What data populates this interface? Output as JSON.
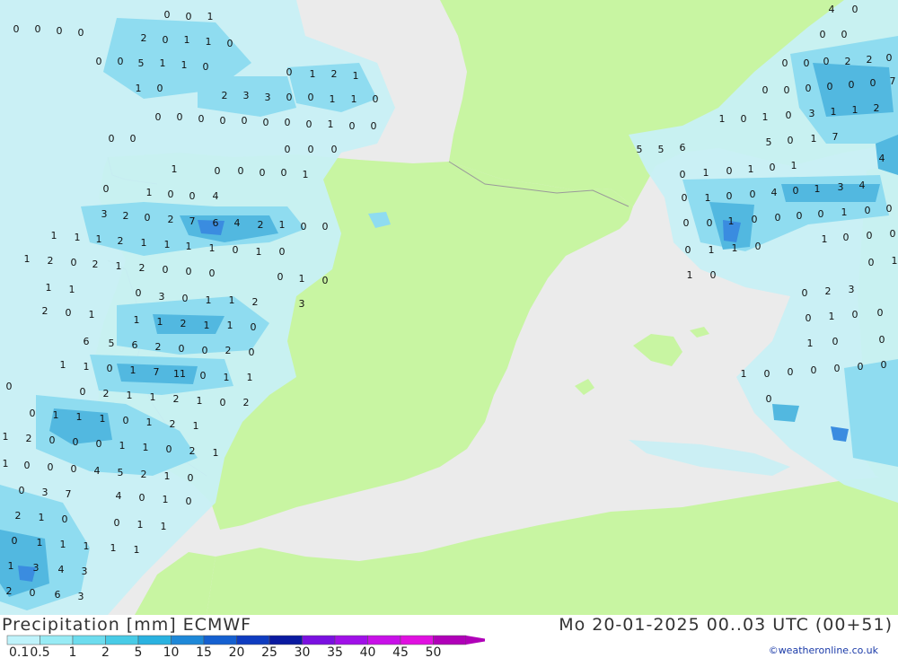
{
  "title": "Precipitation [mm] ECMWF",
  "datetime": "Mo 20-01-2025 00..03 UTC (00+51)",
  "credit": "©weatheronline.co.uk",
  "colors": {
    "sea": "#ebebeb",
    "land": "#c8f5a2",
    "border": "#9a9a9a",
    "precip_low": "#c8f0f5",
    "precip_mid": "#8fdcf0",
    "precip_high": "#52b8e0",
    "precip_max": "#3a8ce0"
  },
  "legend": {
    "labels": [
      "0.1",
      "0.5",
      "1",
      "2",
      "5",
      "10",
      "15",
      "20",
      "25",
      "30",
      "35",
      "40",
      "45",
      "50"
    ],
    "colors": [
      "#bff3fb",
      "#98ebf5",
      "#6ddcee",
      "#48cbe6",
      "#2ab2e0",
      "#1e88d8",
      "#1560d0",
      "#0f3cc0",
      "#0a1aa0",
      "#7a10e0",
      "#a010e8",
      "#c810e8",
      "#e010e0",
      "#b000b8"
    ]
  },
  "precip_values": [
    "0",
    "0",
    "0",
    "0",
    "0",
    "0",
    "1",
    "2",
    "0",
    "1",
    "1",
    "0",
    "0",
    "0",
    "5",
    "1",
    "1",
    "0",
    "1",
    "0",
    "2",
    "3",
    "3",
    "0",
    "1",
    "2",
    "1",
    "0",
    "0",
    "1",
    "1",
    "0",
    "0",
    "0",
    "0",
    "0",
    "0",
    "0",
    "0",
    "0",
    "1",
    "0",
    "0",
    "0",
    "0",
    "0",
    "0",
    "0",
    "1",
    "0",
    "0",
    "0",
    "0",
    "1",
    "0",
    "1",
    "0",
    "0",
    "4",
    "3",
    "2",
    "0",
    "2",
    "7",
    "6",
    "4",
    "2",
    "1",
    "0",
    "0",
    "1",
    "1",
    "1",
    "2",
    "1",
    "1",
    "1",
    "1",
    "0",
    "1",
    "0",
    "1",
    "2",
    "0",
    "2",
    "1",
    "2",
    "0",
    "0",
    "0",
    "0",
    "1",
    "0",
    "1",
    "1",
    "0",
    "3",
    "0",
    "1",
    "1",
    "2",
    "3",
    "2",
    "0",
    "1",
    "1",
    "1",
    "2",
    "1",
    "1",
    "0",
    "6",
    "5",
    "6",
    "2",
    "0",
    "0",
    "2",
    "0",
    "1",
    "1",
    "0",
    "1",
    "7",
    "11",
    "0",
    "1",
    "1",
    "0",
    "2",
    "1",
    "1",
    "2",
    "1",
    "0",
    "2",
    "0",
    "0",
    "1",
    "1",
    "1",
    "0",
    "1",
    "2",
    "1",
    "1",
    "2",
    "0",
    "0",
    "0",
    "1",
    "1",
    "0",
    "2",
    "1",
    "1",
    "0",
    "0",
    "0",
    "4",
    "5",
    "2",
    "1",
    "0",
    "0",
    "3",
    "7",
    "4",
    "0",
    "1",
    "0",
    "2",
    "1",
    "0",
    "0",
    "1",
    "1",
    "0",
    "1",
    "1",
    "1",
    "1",
    "1",
    "1",
    "3",
    "4",
    "3",
    "2",
    "0",
    "6",
    "3",
    "4",
    "0",
    "0",
    "0",
    "0",
    "0",
    "0",
    "2",
    "2",
    "0",
    "0",
    "0",
    "0",
    "0",
    "0",
    "0",
    "7",
    "1",
    "0",
    "1",
    "0",
    "3",
    "1",
    "1",
    "2",
    "5",
    "5",
    "6",
    "5",
    "0",
    "1",
    "7",
    "4",
    "0",
    "1",
    "0",
    "1",
    "0",
    "1",
    "0",
    "1",
    "0",
    "0",
    "4",
    "0",
    "1",
    "3",
    "4",
    "0",
    "0",
    "1",
    "0",
    "0",
    "0",
    "0",
    "1",
    "0",
    "0",
    "0",
    "1",
    "1",
    "0",
    "1",
    "0",
    "0",
    "0",
    "1",
    "0",
    "0",
    "1",
    "0",
    "2",
    "3",
    "0",
    "1",
    "0",
    "0",
    "1",
    "0",
    "0",
    "1",
    "0",
    "0",
    "0",
    "0",
    "0",
    "0",
    "0"
  ]
}
